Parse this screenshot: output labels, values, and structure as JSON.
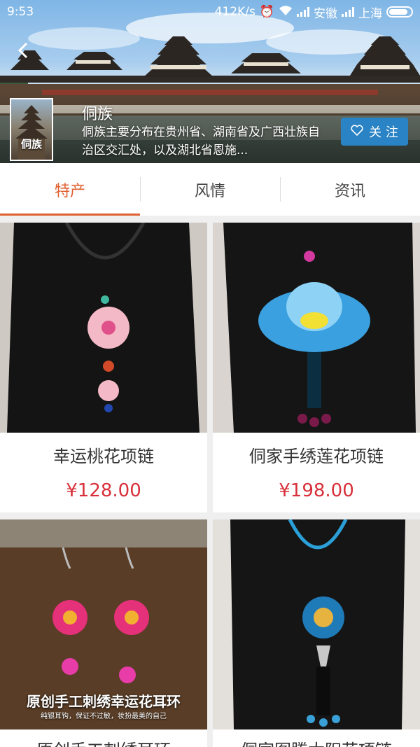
{
  "status_bar": {
    "time": "9:53",
    "speed": "412K/s",
    "carrier1": "安徽",
    "carrier2": "上海"
  },
  "header": {
    "back_icon": "back-arrow-icon",
    "thumb_label": "侗族",
    "title": "侗族",
    "description": "侗族主要分布在贵州省、湖南省及广西壮族自治区交汇处，以及湖北省恩施...",
    "follow_label": "关 注",
    "follow_icon": "heart-outline-icon",
    "follow_color": "#2a83c4"
  },
  "tabs": [
    {
      "label": "特产",
      "active": true
    },
    {
      "label": "风情",
      "active": false
    },
    {
      "label": "资讯",
      "active": false
    }
  ],
  "accent_color": "#e06030",
  "price_color": "#d8303a",
  "products": [
    {
      "name": "幸运桃花项链",
      "price": "¥128.00"
    },
    {
      "name": "侗家手绣莲花项链",
      "price": "¥198.00"
    },
    {
      "name": "原创手工刺绣耳环",
      "overlay_title": "原创手工刺绣幸运花耳环",
      "overlay_sub": "纯银耳钩，保证不过敏，妆扮最美的自己"
    },
    {
      "name": "侗家图腾太阳花项链"
    }
  ]
}
